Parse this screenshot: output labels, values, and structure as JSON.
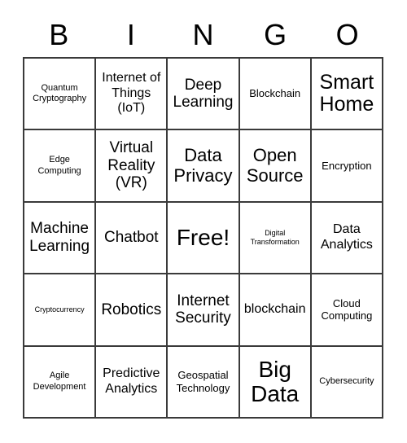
{
  "card": {
    "header_letters": [
      "B",
      "I",
      "N",
      "G",
      "O"
    ],
    "free_space": "Free!",
    "rows": [
      [
        {
          "label": "Quantum Cryptography",
          "size": "xs"
        },
        {
          "label": "Internet of Things (IoT)",
          "size": "m"
        },
        {
          "label": "Deep Learning",
          "size": "l"
        },
        {
          "label": "Blockchain",
          "size": "s"
        },
        {
          "label": "Smart Home",
          "size": "xxl"
        }
      ],
      [
        {
          "label": "Edge Computing",
          "size": "xs"
        },
        {
          "label": "Virtual Reality (VR)",
          "size": "l"
        },
        {
          "label": "Data Privacy",
          "size": "xl"
        },
        {
          "label": "Open Source",
          "size": "xl"
        },
        {
          "label": "Encryption",
          "size": "s"
        }
      ],
      [
        {
          "label": "Machine Learning",
          "size": "l"
        },
        {
          "label": "Chatbot",
          "size": "l"
        },
        {
          "label": "Free!",
          "size": "huge"
        },
        {
          "label": "Digital Transformation",
          "size": "xxs"
        },
        {
          "label": "Data Analytics",
          "size": "m"
        }
      ],
      [
        {
          "label": "Cryptocurrency",
          "size": "xxs"
        },
        {
          "label": "Robotics",
          "size": "l"
        },
        {
          "label": "Internet Security",
          "size": "l"
        },
        {
          "label": "blockchain",
          "size": "m"
        },
        {
          "label": "Cloud Computing",
          "size": "s"
        }
      ],
      [
        {
          "label": "Agile Development",
          "size": "xs"
        },
        {
          "label": "Predictive Analytics",
          "size": "m"
        },
        {
          "label": "Geospatial Technology",
          "size": "s"
        },
        {
          "label": "Big Data",
          "size": "huge"
        },
        {
          "label": "Cybersecurity",
          "size": "xs"
        }
      ]
    ]
  },
  "colors": {
    "background": "#ffffff",
    "text": "#000000",
    "grid_line": "#3a3a3a"
  }
}
